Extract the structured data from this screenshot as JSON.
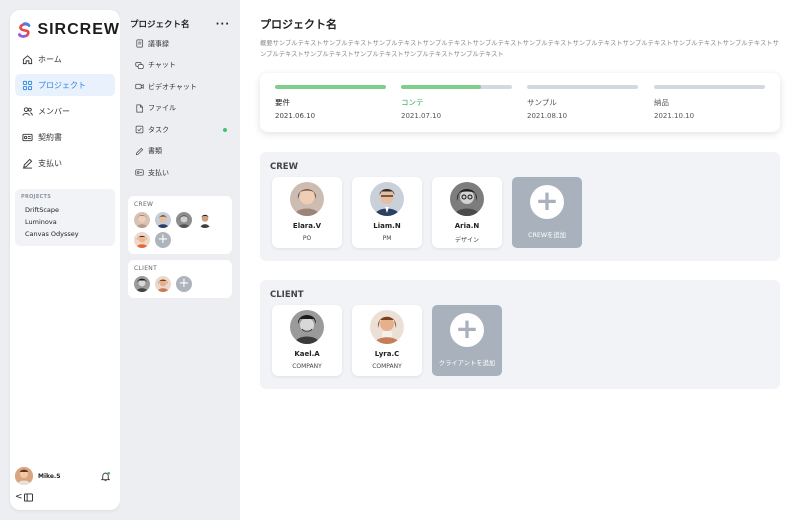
{
  "app": {
    "name": "SIRCREW"
  },
  "nav": {
    "items": [
      {
        "label": "ホーム",
        "icon": "home-icon",
        "active": false
      },
      {
        "label": "プロジェクト",
        "icon": "grid-icon",
        "active": true
      },
      {
        "label": "メンバー",
        "icon": "users-icon",
        "active": false
      },
      {
        "label": "契約書",
        "icon": "contract-icon",
        "active": false
      },
      {
        "label": "支払い",
        "icon": "pen-icon",
        "active": false
      }
    ],
    "projects_title": "PROJECTS",
    "projects": [
      "DriftScape",
      "Luminova",
      "Canvas Odyssey"
    ],
    "user_name": "Mike.S",
    "collapse_label": "<"
  },
  "project_menu": {
    "title": "プロジェクト名",
    "more": "···",
    "items": [
      {
        "label": "議事録",
        "icon": "document-icon"
      },
      {
        "label": "チャット",
        "icon": "chat-icon"
      },
      {
        "label": "ビデオチャット",
        "icon": "video-icon"
      },
      {
        "label": "ファイル",
        "icon": "file-icon"
      },
      {
        "label": "タスク",
        "icon": "task-icon",
        "badge": true
      },
      {
        "label": "書類",
        "icon": "pen-icon"
      },
      {
        "label": "支払い",
        "icon": "payment-icon"
      }
    ],
    "crew_title": "CREW",
    "client_title": "CLIENT",
    "add_symbol": "+"
  },
  "main": {
    "title": "プロジェクト名",
    "description": "概要サンプルテキストサンプルテキストサンプルテキストサンプルテキストサンプルテキストサンプルテキストサンプルテキストサンプルテキストサンプルテキストサンプルテキストサンプルテキストサンプルテキストサンプルテキストサンプルテキストサンプルテキスト",
    "stages": [
      {
        "name": "要件",
        "date": "2021.06.10",
        "progress": 1.0,
        "state": "done"
      },
      {
        "name": "コンテ",
        "date": "2021.07.10",
        "progress": 0.72,
        "state": "current"
      },
      {
        "name": "サンプル",
        "date": "2021.08.10",
        "progress": 0,
        "state": "future"
      },
      {
        "name": "納品",
        "date": "2021.10.10",
        "progress": 0,
        "state": "future"
      }
    ],
    "crew": {
      "title": "CREW",
      "members": [
        {
          "name": "Elara.V",
          "role": "PO"
        },
        {
          "name": "Liam.N",
          "role": "PM"
        },
        {
          "name": "Aria.N",
          "role": "デザイン"
        }
      ],
      "add_label": "CREWを追加"
    },
    "client": {
      "title": "CLIENT",
      "members": [
        {
          "name": "Kael.A",
          "role": "COMPANY"
        },
        {
          "name": "Lyra.C",
          "role": "COMPANY"
        }
      ],
      "add_label": "クライアントを追加"
    },
    "add_symbol": "+"
  },
  "colors": {
    "accent": "#2f86e8",
    "progress": "#7fce8b",
    "current_stage": "#3aa35a",
    "add_card": "#a9b2bc"
  }
}
